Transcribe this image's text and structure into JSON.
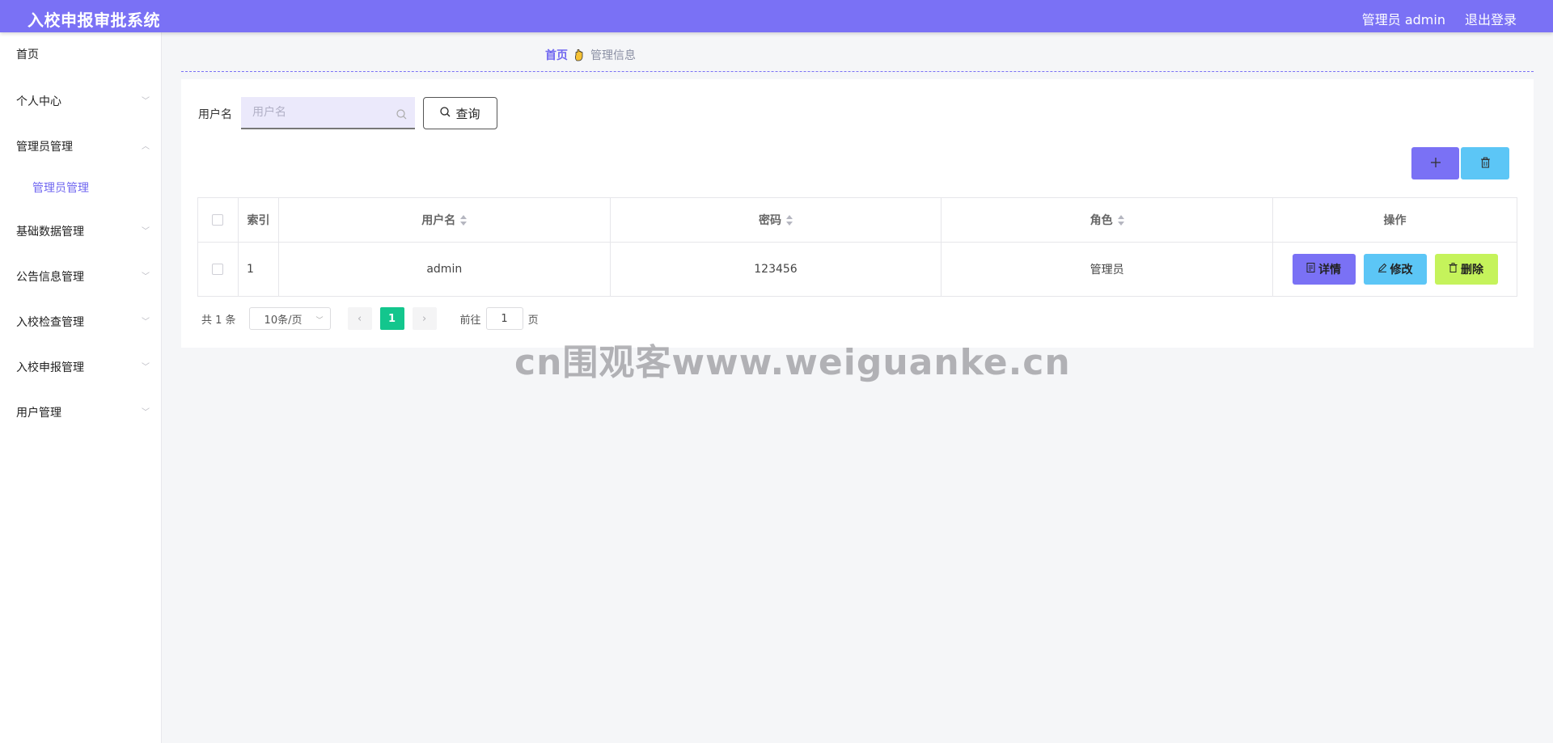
{
  "header": {
    "title": "入校申报审批系统",
    "user_label": "管理员 admin",
    "logout": "退出登录"
  },
  "sidebar": {
    "items": [
      {
        "label": "首页"
      },
      {
        "label": "个人中心"
      },
      {
        "label": "管理员管理"
      },
      {
        "label": "基础数据管理"
      },
      {
        "label": "公告信息管理"
      },
      {
        "label": "入校检查管理"
      },
      {
        "label": "入校申报管理"
      },
      {
        "label": "用户管理"
      }
    ],
    "submenu": {
      "label": "管理员管理"
    }
  },
  "breadcrumb": {
    "home": "首页",
    "current": "管理信息"
  },
  "search": {
    "label": "用户名",
    "placeholder": "用户名",
    "value": "",
    "query_button": "查询"
  },
  "table": {
    "headers": [
      "索引",
      "用户名",
      "密码",
      "角色",
      "操作"
    ],
    "rows": [
      {
        "index": "1",
        "username": "admin",
        "password": "123456",
        "role": "管理员"
      }
    ],
    "actions": {
      "detail": "详情",
      "edit": "修改",
      "delete": "删除"
    }
  },
  "pagination": {
    "total": "共 1 条",
    "page_size": "10条/页",
    "current_page": "1",
    "goto_prefix": "前往",
    "goto_value": "1",
    "goto_suffix": "页"
  },
  "watermark": "cn围观客www.weiguanke.cn",
  "colors": {
    "primary": "#7a71f5",
    "info": "#5cc6f6",
    "lime": "#c5f35b",
    "success": "#13c68d"
  }
}
